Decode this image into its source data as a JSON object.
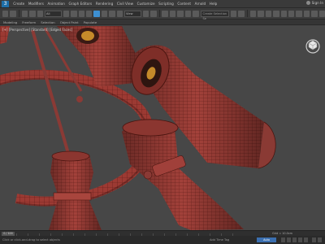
{
  "menubar": {
    "items": [
      "Create",
      "Modifiers",
      "Animation",
      "Graph Editors",
      "Rendering",
      "Civil View",
      "Customize",
      "Scripting",
      "Content",
      "Arnold",
      "Help"
    ],
    "sign_in": "Sign In"
  },
  "toolbar": {
    "filter_label": "All",
    "view_label": "View",
    "selection_set_placeholder": "Create Selection Se"
  },
  "ribbon": {
    "items": [
      "Modeling",
      "Freeform",
      "Selection",
      "Object Paint",
      "Populate"
    ]
  },
  "viewport": {
    "label": "[+] [Perspective] [Standard] [Edged Faces]"
  },
  "timeline": {
    "slider_text": "0 / 100",
    "grid": "Grid = 10.0cm"
  },
  "statusbar": {
    "status": "Click or click-and-drag to select objects",
    "add_time_tag": "Add Time Tag",
    "key_button": "Auto"
  },
  "colors": {
    "mesh_fill": "#9c3a33",
    "mesh_wire": "#5a1a16",
    "accent": "#3d8fd1"
  }
}
